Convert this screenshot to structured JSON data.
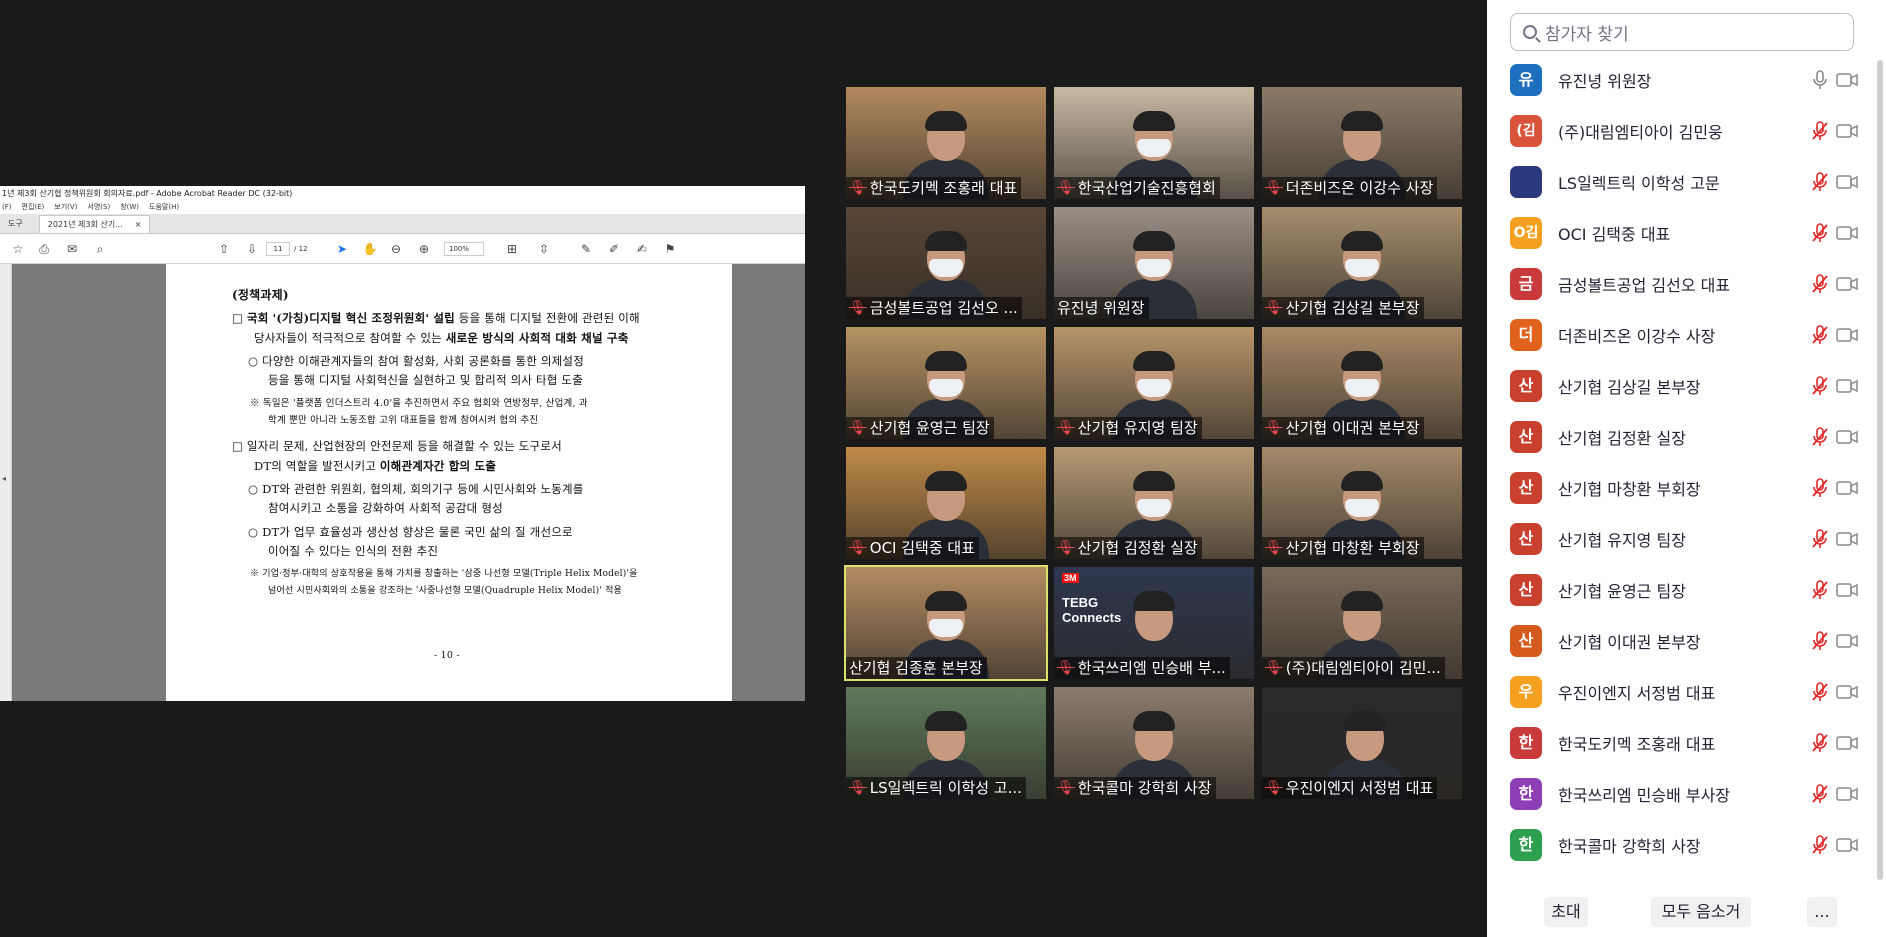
{
  "pdf_viewer": {
    "window_title": "1년 제3회 산기협 정책위원회 회의자료.pdf - Adobe Acrobat Reader DC (32-bit)",
    "menu": [
      "(F)",
      "편집(E)",
      "보기(V)",
      "서명(S)",
      "창(W)",
      "도움말(H)"
    ],
    "tabs": {
      "tools": "도구",
      "document": "2021년 제3회 산기...",
      "close": "×"
    },
    "toolbar": {
      "current_page": "11",
      "total_pages": "/ 12",
      "zoom": "100%"
    },
    "page": {
      "heading": "(정책과제)",
      "line1_pre": "□  ",
      "line1_bold": "국회 '(가칭)디지털 혁신 조정위원회' 설립",
      "line1_post": " 등을 통해 디지털 전환에 관련된 이해",
      "line2_pre": "당사자들이 적극적으로 참여할 수 있는 ",
      "line2_bold": "새로운 방식의 사회적 대화 채널 구축",
      "line3": "○  다양한 이해관계자들의 참여 활성화, 사회 공론화를 통한 의제설정",
      "line4": "등을 통해 디지털 사회혁신을 실현하고 및 합리적 의사 타협 도출",
      "line5": "※  독일은 '플랫폼 인더스트리 4.0'을 추진하면서 주요 협회와 연방정부, 산업계, 과",
      "line6": "학계 뿐만 아니라 노동조합 고위 대표들을 함께 참여시켜 협의 추진",
      "line7": "□  일자리 문제, 산업현장의 안전문제 등을 해결할 수 있는 도구로서",
      "line8_pre": "DT의 역할을 발전시키고 ",
      "line8_bold": "이해관계자간 합의 도출",
      "line9": "○  DT와 관련한 위원회, 협의체, 회의기구 등에 시민사회와 노동계를",
      "line10": "참여시키고 소통을 강화하여 사회적 공감대 형성",
      "line11": "○  DT가 업무 효율성과 생산성 향상은 물론 국민 삶의 질 개선으로",
      "line12": "이어질 수 있다는 인식의 전환 추진",
      "line13": "※  기업·정부·대학의 상호작용을 통해 가치를 창출하는 '삼중 나선형 모델(Triple Helix Model)'을",
      "line14": "넘어선 시민사회와의 소통을 강조하는 '사중나선형 모델(Quadruple Helix Model)' 적용",
      "page_number": "- 10 -"
    }
  },
  "gallery": {
    "tiles": [
      {
        "name": "한국도키멕 조홍래 대표",
        "muted": true,
        "bg": "#b38a5e",
        "mask": false
      },
      {
        "name": "한국산업기술진흥협회",
        "muted": true,
        "bg": "#c9b9a2",
        "mask": true
      },
      {
        "name": "더존비즈온 이강수 사장",
        "muted": true,
        "bg": "#8c7a66",
        "mask": false
      },
      {
        "name": "금성볼트공업 김선오 ...",
        "muted": true,
        "bg": "#5a4636",
        "mask": true
      },
      {
        "name": "유진녕 위원장",
        "muted": false,
        "bg": "#9b8f85",
        "mask": true
      },
      {
        "name": "산기협 김상길 본부장",
        "muted": true,
        "bg": "#a68e6c",
        "mask": true
      },
      {
        "name": "산기협 윤영근 팀장",
        "muted": true,
        "bg": "#b79364",
        "mask": true
      },
      {
        "name": "산기협 유지영 팀장",
        "muted": true,
        "bg": "#b7956a",
        "mask": true
      },
      {
        "name": "산기협 이대권 본부장",
        "muted": true,
        "bg": "#a98a66",
        "mask": true
      },
      {
        "name": "OCI 김택중 대표",
        "muted": true,
        "bg": "#c08a48",
        "mask": false
      },
      {
        "name": "산기협 김정환 실장",
        "muted": true,
        "bg": "#b69a74",
        "mask": true
      },
      {
        "name": "산기협 마창환 부회장",
        "muted": true,
        "bg": "#a58a6a",
        "mask": true
      },
      {
        "name": "산기협 김종훈 본부장",
        "muted": false,
        "bg": "#b48c62",
        "mask": true
      },
      {
        "name": "한국쓰리엠 민승배 부...",
        "muted": true,
        "bg": "#2e3850",
        "mask": false
      },
      {
        "name": "(주)대림엠티아이 김민...",
        "muted": true,
        "bg": "#7a6a58",
        "mask": false
      },
      {
        "name": "LS일렉트릭 이학성 고...",
        "muted": true,
        "bg": "#5f7a5a",
        "mask": false
      },
      {
        "name": "한국콜마 강학희 사장",
        "muted": true,
        "bg": "#8c7c6c",
        "mask": false
      },
      {
        "name": "우진이엔지 서정범 대표",
        "muted": true,
        "bg": "#2a2a2a",
        "mask": false
      }
    ],
    "tebg_line1": "TEBG",
    "tebg_line2": "Connects",
    "logo_3m": "3M"
  },
  "participants": {
    "search_placeholder": "참가자 찾기",
    "list": [
      {
        "initial": "유",
        "color": "#1f6fbf",
        "name": "유진녕 위원장",
        "muted": false
      },
      {
        "initial": "(김",
        "color": "#d9533b",
        "name": "(주)대림엠티아이 김민웅",
        "muted": true
      },
      {
        "initial": "",
        "color": "#2b3a7a",
        "name": "LS일렉트릭 이학성 고문",
        "muted": true
      },
      {
        "initial": "O김",
        "color": "#f5a020",
        "name": "OCI 김택중 대표",
        "muted": true
      },
      {
        "initial": "금",
        "color": "#c93b3b",
        "name": "금성볼트공업 김선오 대표",
        "muted": true
      },
      {
        "initial": "더",
        "color": "#e0621c",
        "name": "더존비즈온 이강수 사장",
        "muted": true
      },
      {
        "initial": "산",
        "color": "#c9402f",
        "name": "산기협 김상길 본부장",
        "muted": true
      },
      {
        "initial": "산",
        "color": "#c9402f",
        "name": "산기협 김정환 실장",
        "muted": true
      },
      {
        "initial": "산",
        "color": "#c9402f",
        "name": "산기협 마창환 부회장",
        "muted": true
      },
      {
        "initial": "산",
        "color": "#c9402f",
        "name": "산기협 유지영 팀장",
        "muted": true
      },
      {
        "initial": "산",
        "color": "#c9402f",
        "name": "산기협 윤영근 팀장",
        "muted": true
      },
      {
        "initial": "산",
        "color": "#d65a1e",
        "name": "산기협 이대권 본부장",
        "muted": true
      },
      {
        "initial": "우",
        "color": "#f5a020",
        "name": "우진이엔지 서정범 대표",
        "muted": true
      },
      {
        "initial": "한",
        "color": "#c93b3b",
        "name": "한국도키멕 조홍래 대표",
        "muted": true
      },
      {
        "initial": "한",
        "color": "#8e3fb8",
        "name": "한국쓰리엠 민승배 부사장",
        "muted": true
      },
      {
        "initial": "한",
        "color": "#2e9e4f",
        "name": "한국콜마 강학희 사장",
        "muted": true
      }
    ],
    "footer": {
      "invite": "초대",
      "mute_all": "모두 음소거",
      "more": "..."
    }
  }
}
